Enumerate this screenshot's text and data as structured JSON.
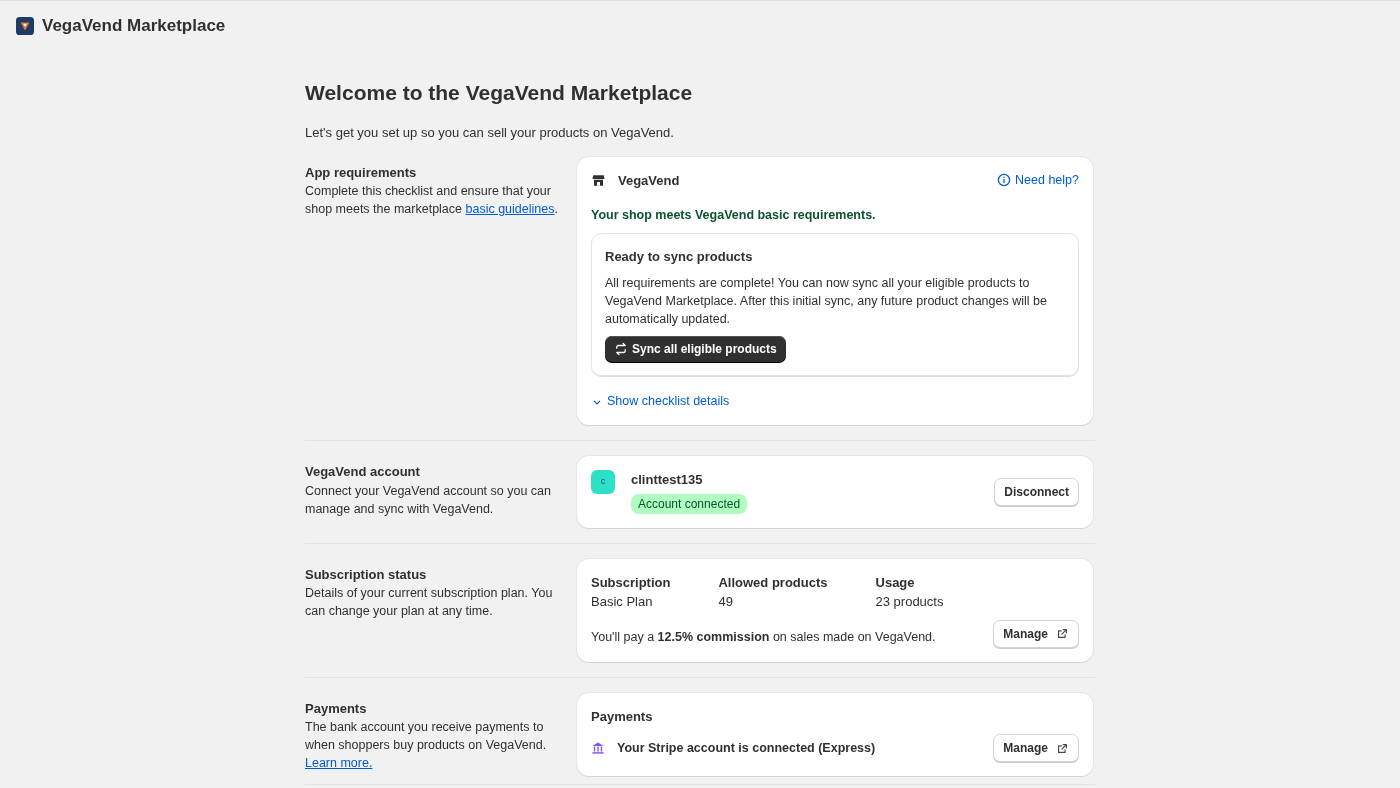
{
  "header": {
    "title": "VegaVend Marketplace"
  },
  "page": {
    "title": "Welcome to the VegaVend Marketplace",
    "subtitle": "Let's get you set up so you can sell your products on VegaVend."
  },
  "sections": [
    {
      "kind": "requirements",
      "title": "App requirements",
      "description": "Complete this checklist and ensure that your shop meets the marketplace",
      "link": "basic guidelines",
      "after_link": ".",
      "card": {
        "brand": "VegaVend",
        "help": "Need help?",
        "status": "Your shop meets VegaVend basic requirements.",
        "panel_title": "Ready to sync products",
        "panel_text": "All requirements are complete! You can now sync all your eligible products to VegaVend Marketplace. After this initial sync, any future product changes will be automatically updated.",
        "button": "Sync all eligible products",
        "toggle": "Show checklist details",
        "expanded": false
      }
    },
    {
      "kind": "account",
      "title": "VegaVend account",
      "description": "Connect your VegaVend account so you can manage and sync with VegaVend.",
      "card": {
        "avatar": "c",
        "username": "clinttest135",
        "badge": "Account connected",
        "button": "Disconnect"
      }
    },
    {
      "kind": "subscription",
      "title": "Subscription status",
      "description": "Details of your current subscription plan. You can change your plan at any time.",
      "card": {
        "stats": [
          {
            "label": "Subscription",
            "value": "Basic Plan"
          },
          {
            "label": "Allowed products",
            "value": "49"
          },
          {
            "label": "Usage",
            "value": "23 products"
          }
        ],
        "note": "You'll pay a **12.5% commission** on sales made on VegaVend.",
        "button": "Manage"
      }
    },
    {
      "kind": "payments",
      "title": "Payments",
      "description": "The bank account you receive payments to when shoppers buy products on VegaVend.",
      "link": "Learn more.",
      "card": {
        "title": "Payments",
        "status": "Your Stripe account is connected (Express)",
        "button": "Manage"
      }
    }
  ]
}
